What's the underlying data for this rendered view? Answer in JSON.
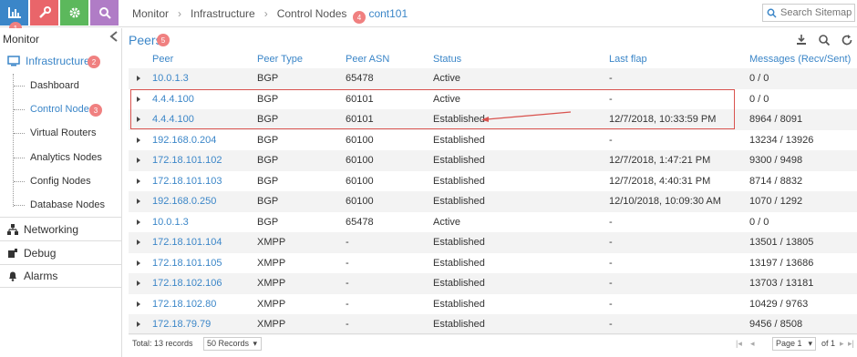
{
  "topbar": {
    "buttons": [
      {
        "name": "monitor-tab-button",
        "icon": "bar-chart-icon",
        "color": "#3b86c8",
        "badge": "1"
      },
      {
        "name": "configure-tab-button",
        "icon": "wrench-icon",
        "color": "#e9656a"
      },
      {
        "name": "settings-tab-button",
        "icon": "gear-icon",
        "color": "#5cb85c"
      },
      {
        "name": "query-tab-button",
        "icon": "search-icon",
        "color": "#b07cc6"
      }
    ],
    "breadcrumb": [
      "Monitor",
      "Infrastructure",
      "Control Nodes",
      "cont101"
    ],
    "breadcrumb_badge": "4",
    "search_placeholder": "Search Sitemap"
  },
  "sidebar": {
    "title": "Monitor",
    "sections": [
      {
        "label": "Infrastructure",
        "icon": "monitor-icon",
        "badge": "2",
        "active": true
      },
      {
        "label": "Networking",
        "icon": "network-icon"
      },
      {
        "label": "Debug",
        "icon": "debug-icon"
      },
      {
        "label": "Alarms",
        "icon": "bell-icon"
      }
    ],
    "infrastructure_items": [
      {
        "label": "Dashboard"
      },
      {
        "label": "Control Nodes",
        "active": true,
        "badge": "3"
      },
      {
        "label": "Virtual Routers"
      },
      {
        "label": "Analytics Nodes"
      },
      {
        "label": "Config Nodes"
      },
      {
        "label": "Database Nodes"
      }
    ]
  },
  "peers": {
    "title": "Peers",
    "badge": "5",
    "columns": [
      "Peer",
      "Peer Type",
      "Peer ASN",
      "Status",
      "Last flap",
      "Messages (Recv/Sent)"
    ],
    "rows": [
      [
        "10.0.1.3",
        "BGP",
        "65478",
        "Active",
        "-",
        "0 / 0"
      ],
      [
        "4.4.4.100",
        "BGP",
        "60101",
        "Active",
        "-",
        "0 / 0"
      ],
      [
        "4.4.4.100",
        "BGP",
        "60101",
        "Established",
        "12/7/2018, 10:33:59 PM",
        "8964 / 8091"
      ],
      [
        "192.168.0.204",
        "BGP",
        "60100",
        "Established",
        "-",
        "13234 / 13926"
      ],
      [
        "172.18.101.102",
        "BGP",
        "60100",
        "Established",
        "12/7/2018, 1:47:21 PM",
        "9300 / 9498"
      ],
      [
        "172.18.101.103",
        "BGP",
        "60100",
        "Established",
        "12/7/2018, 4:40:31 PM",
        "8714 / 8832"
      ],
      [
        "192.168.0.250",
        "BGP",
        "60100",
        "Established",
        "12/10/2018, 10:09:30 AM",
        "1070 / 1292"
      ],
      [
        "10.0.1.3",
        "BGP",
        "65478",
        "Active",
        "-",
        "0 / 0"
      ],
      [
        "172.18.101.104",
        "XMPP",
        "-",
        "Established",
        "-",
        "13501 / 13805"
      ],
      [
        "172.18.101.105",
        "XMPP",
        "-",
        "Established",
        "-",
        "13197 / 13686"
      ],
      [
        "172.18.102.106",
        "XMPP",
        "-",
        "Established",
        "-",
        "13703 / 13181"
      ],
      [
        "172.18.102.80",
        "XMPP",
        "-",
        "Established",
        "-",
        "10429 / 9763"
      ],
      [
        "172.18.79.79",
        "XMPP",
        "-",
        "Established",
        "-",
        "9456 / 8508"
      ]
    ],
    "footer": {
      "total": "Total: 13 records",
      "page_size": "50 Records",
      "page": "Page 1",
      "of": "of 1"
    }
  }
}
